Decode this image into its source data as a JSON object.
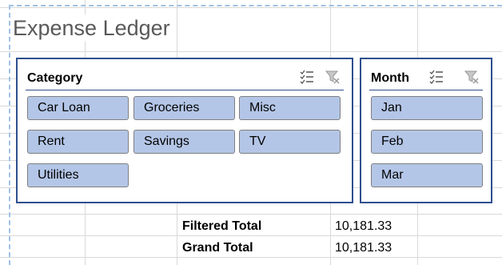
{
  "sheet": {
    "title": "Expense Ledger"
  },
  "category_slicer": {
    "title": "Category",
    "items": [
      "Car Loan",
      "Groceries",
      "Misc",
      "Rent",
      "Savings",
      "TV",
      "Utilities"
    ]
  },
  "month_slicer": {
    "title": "Month",
    "items": [
      "Jan",
      "Feb",
      "Mar"
    ]
  },
  "totals": {
    "filtered_label": "Filtered Total",
    "filtered_value": "10,181.33",
    "grand_label": "Grand Total",
    "grand_value": "10,181.33"
  },
  "colors": {
    "slicer_border": "#2f4f8f",
    "item_fill": "#b4c6e7",
    "selection_dash": "#9dc3e6"
  }
}
